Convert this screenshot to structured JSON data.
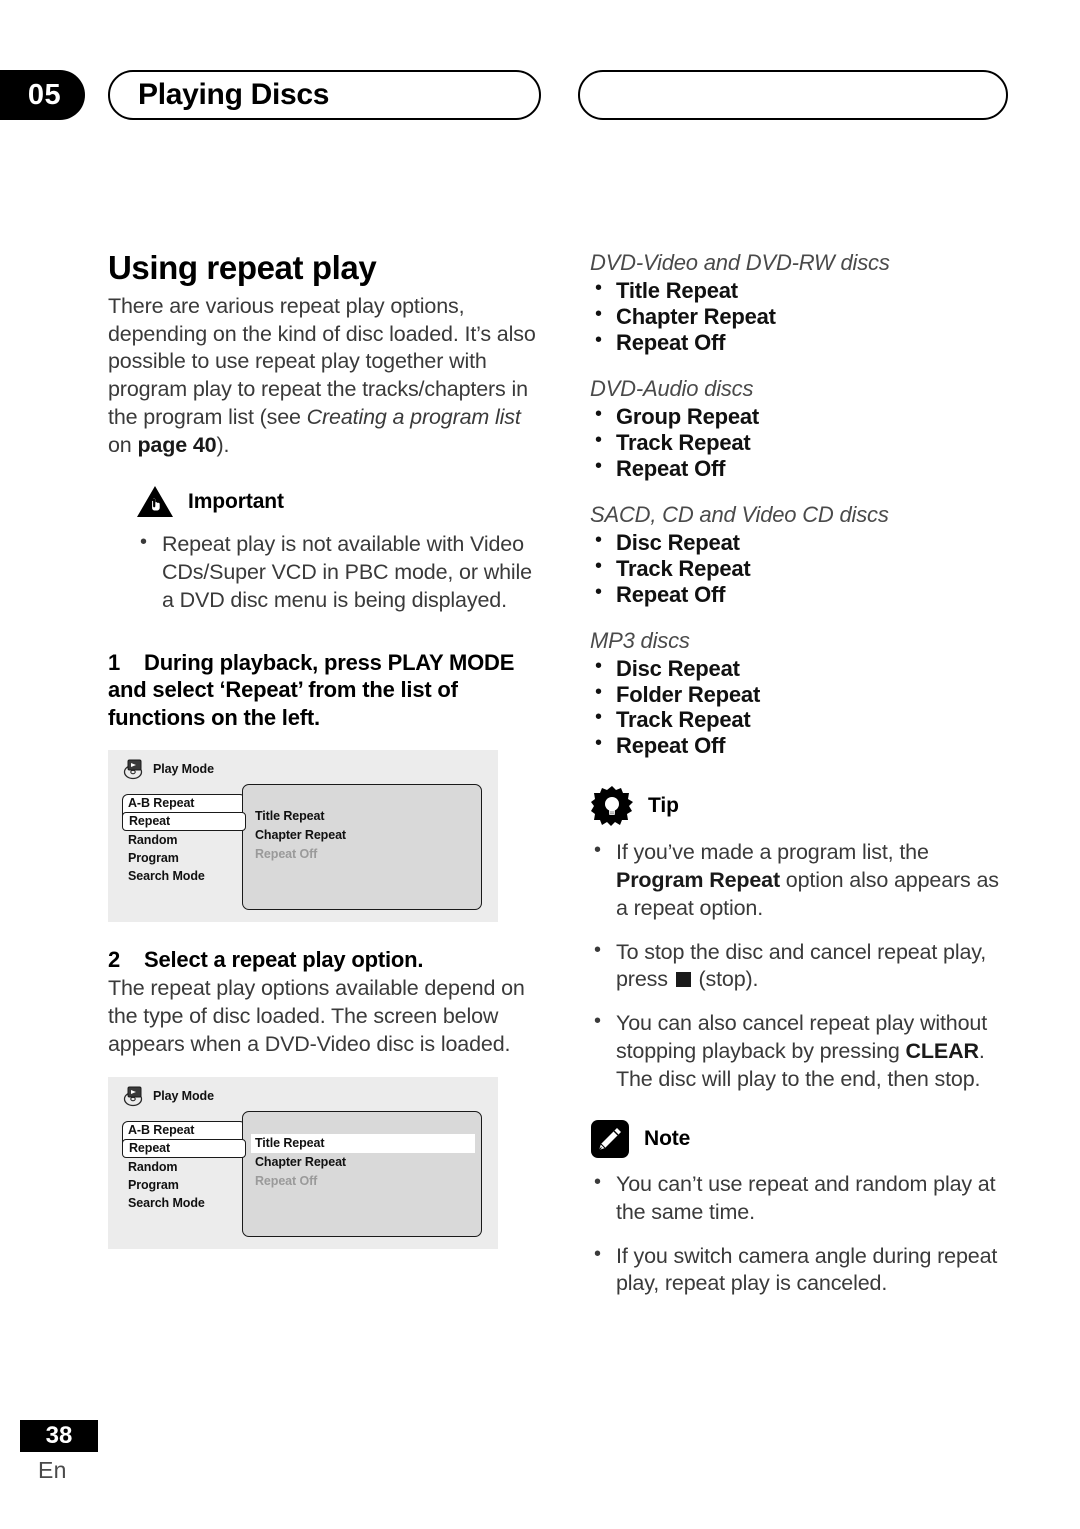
{
  "header": {
    "chapter_number": "05",
    "title": "Playing Discs"
  },
  "left_column": {
    "section_title": "Using repeat play",
    "intro_part1": "There are various repeat play options, depending on the kind of disc loaded. It’s also possible to use repeat play together with program play to repeat the tracks/chapters in the program list (see ",
    "intro_italic": "Creating a program list",
    "intro_part2": " on ",
    "intro_bold": "page 40",
    "intro_part3": ").",
    "important": {
      "label": "Important",
      "icon": "warning-triangle-hand-icon",
      "bullets": [
        "Repeat play is not available with Video CDs/Super VCD in PBC mode, or while a DVD disc menu is being displayed."
      ]
    },
    "steps": [
      {
        "number": "1",
        "text": "During playback, press PLAY MODE and select ‘Repeat’ from the list of functions on the left."
      },
      {
        "number": "2",
        "text": "Select a repeat play option.",
        "body": "The repeat play options available depend on the type of disc loaded. The screen below appears when a DVD-Video disc is loaded."
      }
    ],
    "osd_screens": [
      {
        "title": "Play Mode",
        "icon": "disc-screen-icon",
        "menu_items": [
          "A-B Repeat",
          "Repeat",
          "Random",
          "Program",
          "Search Mode"
        ],
        "selected_menu_item": "Repeat",
        "options": [
          {
            "label": "Title Repeat",
            "state": "normal"
          },
          {
            "label": "Chapter Repeat",
            "state": "normal"
          },
          {
            "label": "Repeat Off",
            "state": "dimmed"
          }
        ]
      },
      {
        "title": "Play Mode",
        "icon": "disc-screen-icon",
        "menu_items": [
          "A-B Repeat",
          "Repeat",
          "Random",
          "Program",
          "Search Mode"
        ],
        "selected_menu_item": "Repeat",
        "options": [
          {
            "label": "Title Repeat",
            "state": "highlighted"
          },
          {
            "label": "Chapter Repeat",
            "state": "normal"
          },
          {
            "label": "Repeat Off",
            "state": "dimmed"
          }
        ]
      }
    ]
  },
  "right_column": {
    "disc_groups": [
      {
        "heading": "DVD-Video and DVD-RW discs",
        "options": [
          "Title Repeat",
          "Chapter Repeat",
          "Repeat Off"
        ]
      },
      {
        "heading": "DVD-Audio discs",
        "options": [
          "Group Repeat",
          "Track Repeat",
          "Repeat Off"
        ]
      },
      {
        "heading": "SACD, CD and Video CD discs",
        "options": [
          "Disc Repeat",
          "Track Repeat",
          "Repeat Off"
        ]
      },
      {
        "heading": "MP3 discs",
        "options": [
          "Disc Repeat",
          "Folder Repeat",
          "Track Repeat",
          "Repeat Off"
        ]
      }
    ],
    "tip": {
      "label": "Tip",
      "icon": "lightbulb-starburst-icon",
      "bullet1_part1": "If you’ve made a program list, the ",
      "bullet1_bold": "Program Repeat",
      "bullet1_part2": " option also appears as a repeat option.",
      "bullet2_part1": "To stop the disc and cancel repeat play, press ",
      "bullet2_glyph": "stop-square-icon",
      "bullet2_part2": " (stop).",
      "bullet3_part1": "You can also cancel repeat play without stopping playback by pressing ",
      "bullet3_bold": "CLEAR",
      "bullet3_part2": ". The disc will play to the end, then stop."
    },
    "note": {
      "label": "Note",
      "icon": "pencil-note-icon",
      "bullets": [
        "You can’t use repeat and random play at the same time.",
        "If you switch camera angle during repeat play, repeat play is canceled."
      ]
    }
  },
  "footer": {
    "page_number": "38",
    "language_code": "En"
  }
}
